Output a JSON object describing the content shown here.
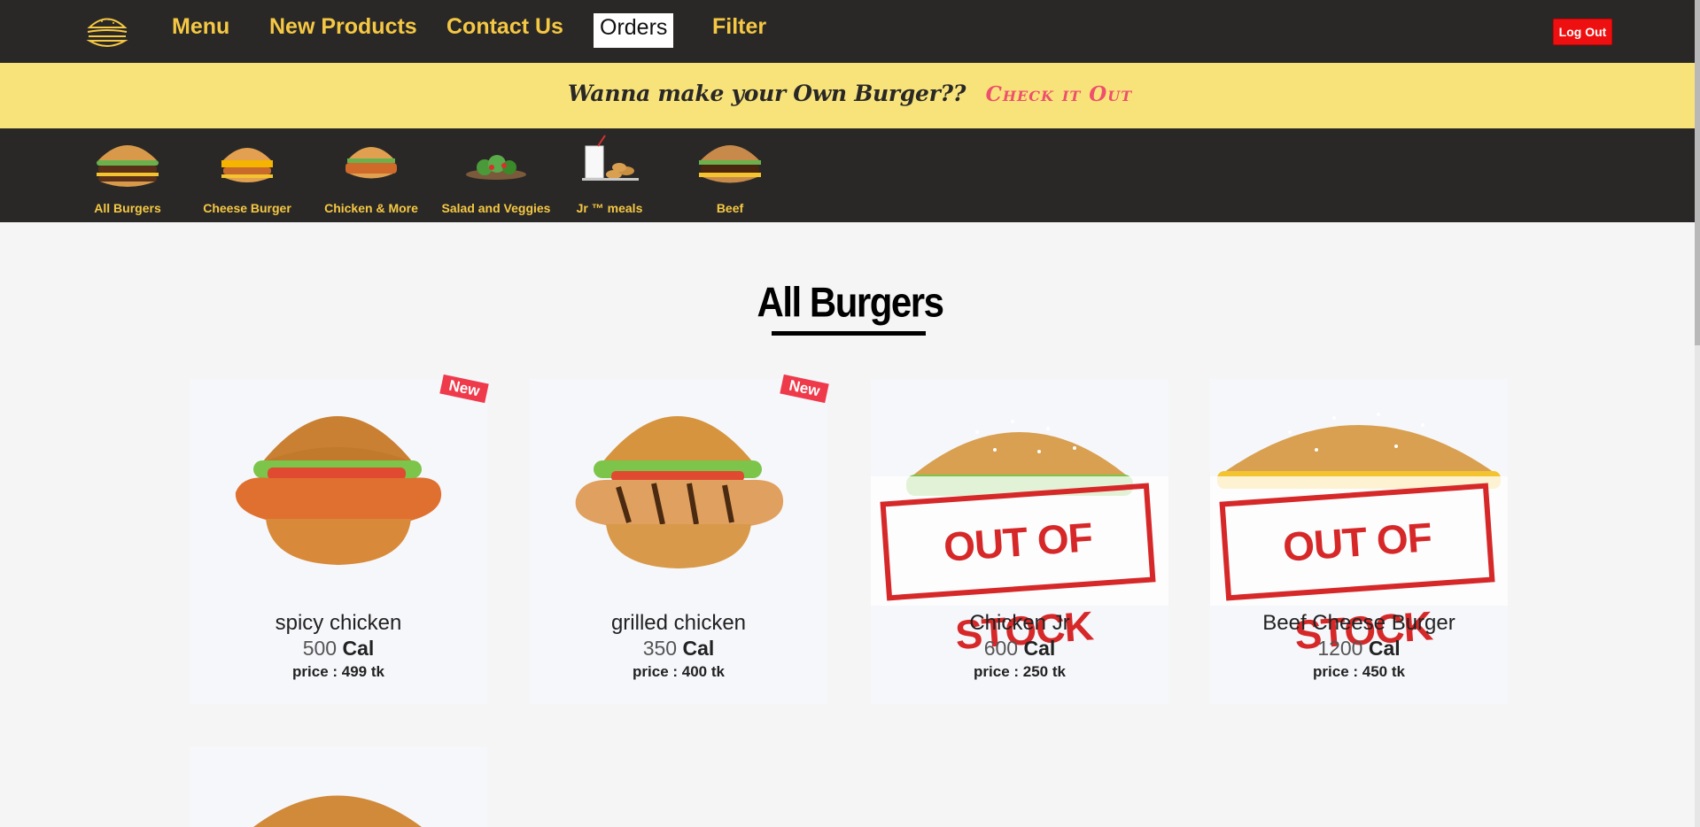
{
  "nav": {
    "logo": "burger-logo",
    "items": [
      {
        "label": "Menu"
      },
      {
        "label": "New Products"
      },
      {
        "label": "Contact Us"
      },
      {
        "label": "Orders",
        "active": true
      },
      {
        "label": "Filter"
      }
    ],
    "logout_label": "Log Out"
  },
  "promo": {
    "text": "Wanna make your Own Burger??",
    "link": "Check it Out"
  },
  "categories": [
    {
      "label": "All Burgers",
      "icon": "burger-icon"
    },
    {
      "label": "Cheese Burger",
      "icon": "cheese-burger-icon"
    },
    {
      "label": "Chicken & More",
      "icon": "chicken-burger-icon"
    },
    {
      "label": "Salad and Veggies",
      "icon": "salad-icon"
    },
    {
      "label": "Jr ™ meals",
      "icon": "kids-meal-icon"
    },
    {
      "label": "Beef",
      "icon": "beef-burger-icon"
    }
  ],
  "section_title": "All Burgers",
  "products": [
    {
      "name": "spicy chicken",
      "calories": "500",
      "cal_unit": "Cal",
      "price": "price : 499 tk",
      "badge": "New",
      "out_of_stock": false
    },
    {
      "name": "grilled chicken",
      "calories": "350",
      "cal_unit": "Cal",
      "price": "price : 400 tk",
      "badge": "New",
      "out_of_stock": false
    },
    {
      "name": "Chicken Jr",
      "calories": "600",
      "cal_unit": "Cal",
      "price": "price : 250 tk",
      "badge": "",
      "out_of_stock": true,
      "stamp": "OUT OF STOCK"
    },
    {
      "name": "Beef Cheese Burger",
      "calories": "1200",
      "cal_unit": "Cal",
      "price": "price : 450 tk",
      "badge": "",
      "out_of_stock": true,
      "stamp": "OUT OF STOCK"
    }
  ],
  "colors": {
    "nav_bg": "#2a2826",
    "accent": "#f5c844",
    "promo_bg": "#f8e37b",
    "promo_link": "#ee4f6c",
    "logout": "#ee1010",
    "badge": "#ee3a4b",
    "stamp": "#d62828"
  }
}
